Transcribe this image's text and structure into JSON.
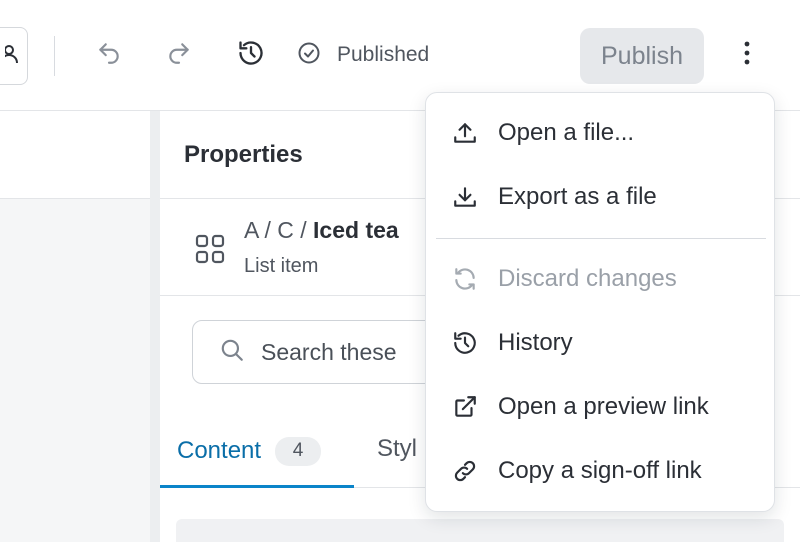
{
  "toolbar": {
    "status_label": "Published",
    "publish_label": "Publish"
  },
  "panel": {
    "title": "Properties",
    "breadcrumb": {
      "prefix": "A / C / ",
      "current": "Iced tea"
    },
    "item_type": "List item",
    "search": {
      "placeholder": "Search these"
    },
    "tabs": [
      {
        "label": "Content",
        "count": "4"
      },
      {
        "label": "Styl"
      }
    ]
  },
  "menu": {
    "items": [
      {
        "label": "Open a file...",
        "icon": "upload-icon",
        "disabled": false
      },
      {
        "label": "Export as a file",
        "icon": "download-icon",
        "disabled": false
      },
      {
        "label": "Discard changes",
        "icon": "refresh-icon",
        "disabled": true
      },
      {
        "label": "History",
        "icon": "history-icon",
        "disabled": false
      },
      {
        "label": "Open a preview link",
        "icon": "external-link-icon",
        "disabled": false
      },
      {
        "label": "Copy a sign-off link",
        "icon": "link-icon",
        "disabled": false
      }
    ]
  },
  "colors": {
    "accent": "#0b84c9",
    "accent_text": "#0a6ea8",
    "disabled_text": "#9aa0a8"
  }
}
